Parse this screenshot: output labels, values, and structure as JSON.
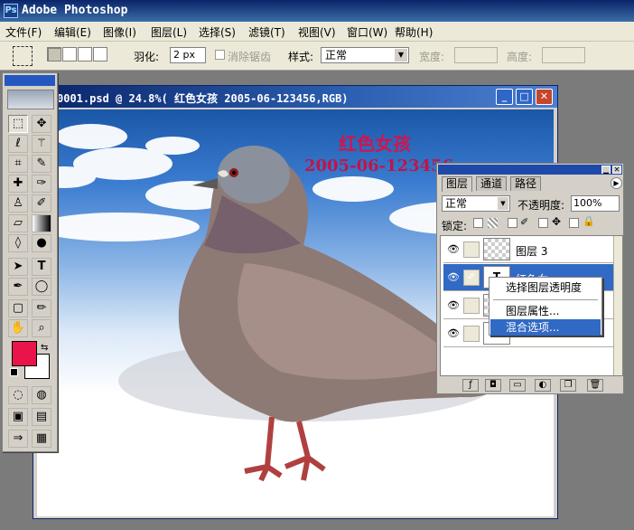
{
  "app": {
    "title": "Adobe Photoshop"
  },
  "menu": [
    "文件(F)",
    "编辑(E)",
    "图像(I)",
    "图层(L)",
    "选择(S)",
    "滤镜(T)",
    "视图(V)",
    "窗口(W)",
    "帮助(H)"
  ],
  "options": {
    "feather_label": "羽化:",
    "feather_value": "2 px",
    "antialias_label": "消除锯齿",
    "style_label": "样式:",
    "style_value": "正常",
    "width_label": "宽度:",
    "height_label": "高度:"
  },
  "document": {
    "title": "0001.psd @ 24.8%(  红色女孩 2005-06-123456,RGB)",
    "overlay_title": "红色女孩",
    "overlay_date": "2005-06-123456"
  },
  "layers_panel": {
    "tabs": [
      "图层",
      "通道",
      "路径"
    ],
    "blend_mode": "正常",
    "opacity_label": "不透明度:",
    "opacity_value": "100%",
    "lock_label": "锁定:",
    "layers": [
      {
        "name": "图层 3",
        "visible": true
      },
      {
        "name": "红色女",
        "visible": true,
        "selected": true
      },
      {
        "name": "",
        "visible": true
      },
      {
        "name": "",
        "visible": true
      }
    ]
  },
  "context_menu": {
    "items": [
      "选择图层透明度",
      "图层属性...",
      "混合选项..."
    ],
    "highlighted": 2
  },
  "colors": {
    "foreground": "#e8144a",
    "background": "#ffffff",
    "title_blue": "#0a246a",
    "highlight": "#316ac5"
  }
}
